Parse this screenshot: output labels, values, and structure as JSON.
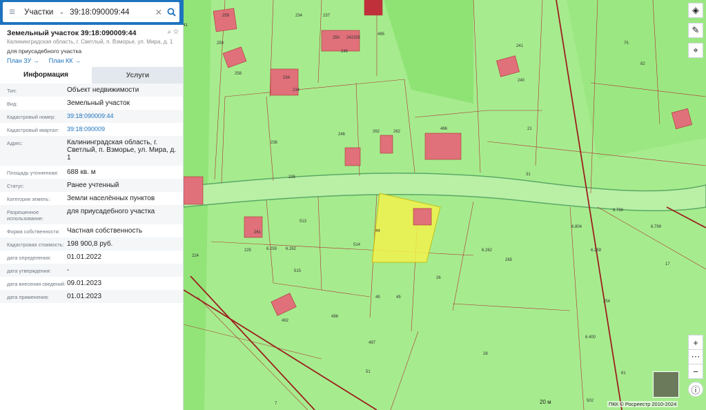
{
  "search": {
    "type_label": "Участки",
    "query": "39:18:090009:44"
  },
  "object": {
    "title": "Земельный участок 39:18:090009:44",
    "address_small": "Калининградская область, г. Светлый, п. Взморье, ул. Мира, д. 1",
    "usage_small": "для приусадебного участка",
    "plan_zu": "План ЗУ →",
    "plan_kk": "План КК →"
  },
  "tabs": {
    "info": "Информация",
    "services": "Услуги"
  },
  "rows": [
    {
      "label": "Тип:",
      "value": "Объект недвижимости"
    },
    {
      "label": "Вид:",
      "value": "Земельный участок"
    },
    {
      "label": "Кадастровый номер:",
      "value": "39:18:090009:44"
    },
    {
      "label": "Кадастровый квартал:",
      "value": "39:18:090009"
    },
    {
      "label": "Адрес:",
      "value": "Калининградская область, г. Светлый, п. Взморье, ул. Мира, д. 1"
    },
    {
      "label": "Площадь уточненная:",
      "value": "688 кв. м"
    },
    {
      "label": "Статус:",
      "value": "Ранее учтенный"
    },
    {
      "label": "Категория земель:",
      "value": "Земли населённых пунктов"
    },
    {
      "label": "Разрешенное использование:",
      "value": "для приусадебного участка"
    },
    {
      "label": "Форма собственности:",
      "value": "Частная собственность"
    },
    {
      "label": "Кадастровая стоимость:",
      "value": "198 900,8 руб."
    },
    {
      "label": "дата определения:",
      "value": "01.01.2022"
    },
    {
      "label": "дата утверждения:",
      "value": "-"
    },
    {
      "label": "дата внесения сведений:",
      "value": "09.01.2023"
    },
    {
      "label": "дата применения:",
      "value": "01.01.2023"
    }
  ],
  "map": {
    "scale_label": "20 м",
    "copyright": "ПКК © Росреестр 2010-2024",
    "labels": [
      "259",
      "241",
      "234",
      "237",
      "485",
      "259",
      "258",
      "234",
      "234",
      "250",
      "242",
      "255",
      "249",
      "246",
      "236",
      "235",
      "262",
      "262",
      "486",
      "241",
      "240",
      "21",
      "31",
      "75",
      "82",
      "6.799",
      "6.804",
      "6.799",
      "513",
      "225",
      "224",
      "6.259",
      "6.262",
      "514",
      "515",
      "261",
      "492",
      "496",
      "497",
      "51",
      "7",
      "45",
      "45",
      "26",
      "6.262",
      "265",
      "28",
      "6.259",
      "17",
      "6.400",
      "61",
      "502",
      "44",
      "254"
    ]
  },
  "colors": {
    "accent": "#1e73be",
    "parcel_fill": "#a6ec8e",
    "zone_fill": "#86e06b",
    "selected_fill": "#f2f24e",
    "building_fill": "#e0707a",
    "boundary": "#b03030"
  }
}
